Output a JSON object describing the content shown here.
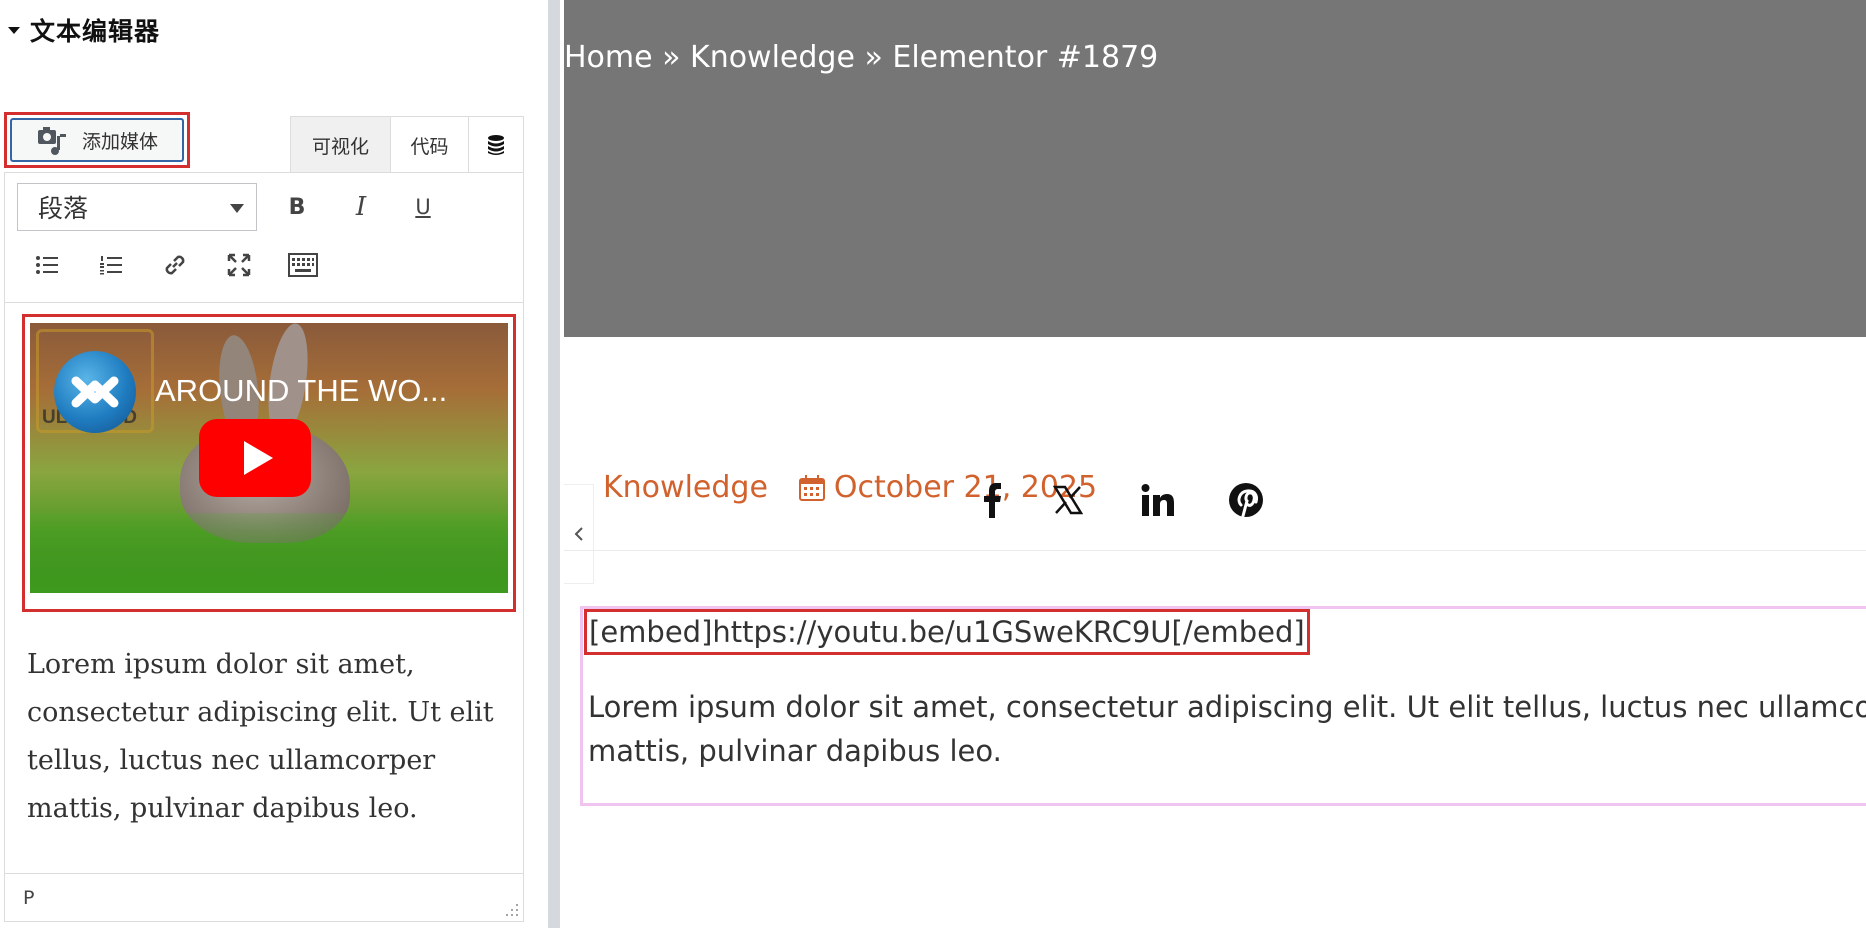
{
  "editor_panel": {
    "section_title": "文本编辑器",
    "add_media_label": "添加媒体",
    "tabs": {
      "visual": "可视化",
      "code": "代码"
    },
    "format_select_value": "段落",
    "toolbar": {
      "bold": "B",
      "italic": "I",
      "underline": "U"
    },
    "video": {
      "title": "AROUND THE WO...",
      "badge_text": "ULTRA HD"
    },
    "paragraph": "Lorem ipsum dolor sit amet, consectetur adipiscing elit. Ut elit tellus, luctus nec ullamcorper mattis, pulvinar dapibus leo.",
    "status_path": "P"
  },
  "preview": {
    "breadcrumb": "Home » Knowledge » Elementor #1879",
    "meta": {
      "category": "Knowledge",
      "date": "October 21, 2025"
    },
    "social_icons": [
      "facebook-icon",
      "x-twitter-icon",
      "linkedin-icon",
      "pinterest-icon"
    ],
    "embed_text": "[embed]https://youtu.be/u1GSweKRC9U[/embed]",
    "paragraph": "Lorem ipsum dolor sit amet, consectetur adipiscing elit. Ut elit tellus, luctus nec ullamcorper mattis, pulvinar dapibus leo."
  },
  "colors": {
    "accent": "#d2622d",
    "highlight_border": "#d42f2f",
    "widget_border": "#f0c4f0",
    "hero_bg": "#767676"
  }
}
